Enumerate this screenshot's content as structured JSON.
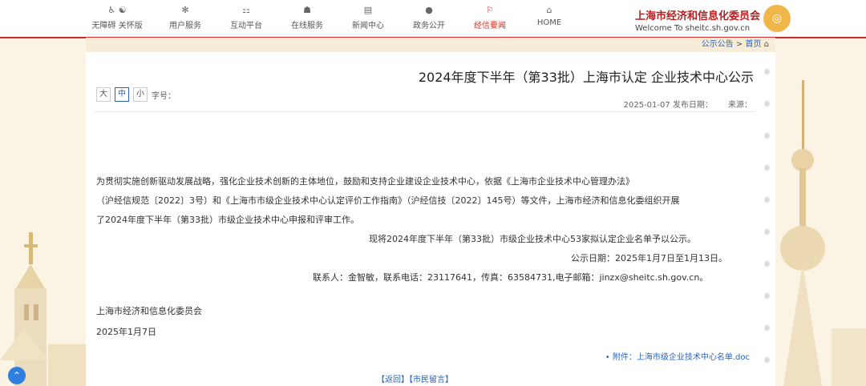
{
  "header": {
    "logo_cn": "上海市经济和信息化委员会",
    "logo_en": "Welcome To sheitc.sh.gov.cn",
    "nav": [
      {
        "label": "HOME",
        "icon": "home-icon"
      },
      {
        "label": "经信要闻",
        "icon": "news-flag-icon"
      },
      {
        "label": "政务公开",
        "icon": "chat-icon"
      },
      {
        "label": "新闻中心",
        "icon": "newspaper-icon"
      },
      {
        "label": "在线服务",
        "icon": "user-service-icon"
      },
      {
        "label": "互动平台",
        "icon": "interaction-icon"
      },
      {
        "label": "用户服务",
        "icon": "settings-icon"
      },
      {
        "label": "无障碍 关怀版",
        "icon": "accessibility-icon"
      }
    ]
  },
  "breadcrumb": {
    "home": "首页",
    "sep": ">",
    "current": "公示公告"
  },
  "article": {
    "title": "2024年度下半年（第33批）上海市认定 企业技术中心公示",
    "fontsize_label": "字号：",
    "fontsize_options": [
      "小",
      "中",
      "大"
    ],
    "source_label": "来源：",
    "date_label": "发布日期：",
    "date": "2025-01-07",
    "paragraphs": [
      "为贯彻实施创新驱动发展战略，强化企业技术创新的主体地位，鼓励和支持企业建设企业技术中心，依据《上海市企业技术中心管理办法》",
      "（沪经信规范〔2022〕3号）和《上海市市级企业技术中心认定评价工作指南》（沪经信技〔2022〕145号）等文件，上海市经济和信息化委组织开展",
      "了2024年度下半年（第33批）市级企业技术中心申报和评审工作。",
      "现将2024年度下半年（第33批）市级企业技术中心53家拟认定企业名单予以公示。",
      "公示日期：2025年1月7日至1月13日。",
      "联系人：金智敏，联系电话：23117641，传真：63584731,电子邮箱：jinzx@sheitc.sh.gov.cn。"
    ],
    "signature": "上海市经济和信息化委员会",
    "signature_date": "2025年1月7日",
    "attachment": "• 附件：上海市级企业技术中心名单.doc",
    "bottom_links": "【返回】【市民留言】"
  },
  "colors": {
    "accent": "#cf2b2b",
    "link": "#2a64b8",
    "background": "#fbf3e4"
  }
}
